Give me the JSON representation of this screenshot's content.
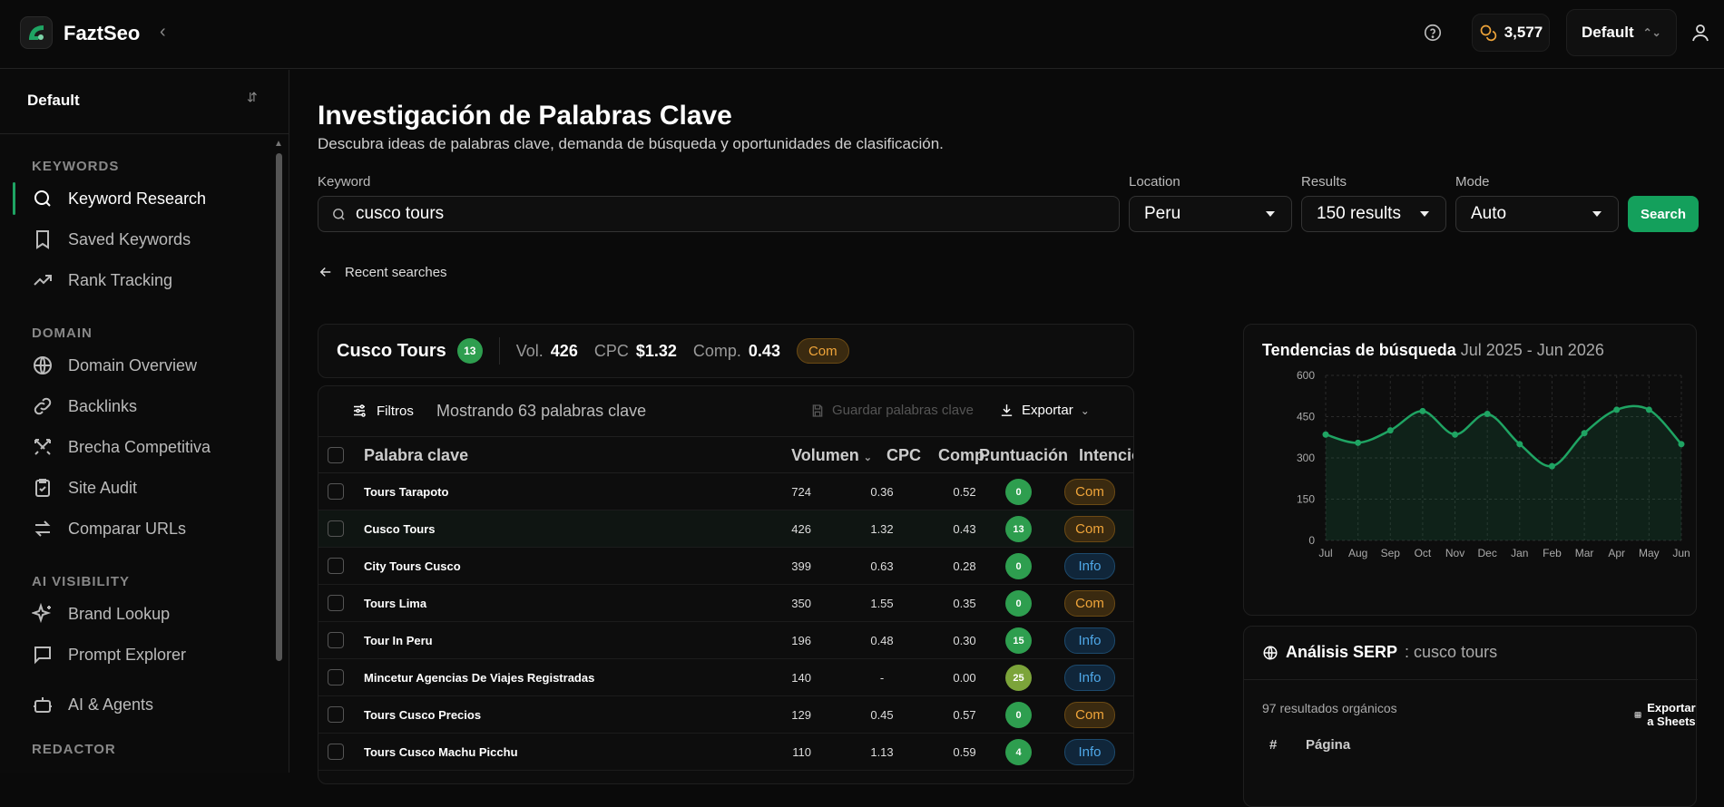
{
  "app": {
    "name": "FaztSeo",
    "credits": "3,577",
    "workspace": "Default"
  },
  "sidebar": {
    "workspace": "Default",
    "sections": {
      "keywords": "KEYWORDS",
      "domain": "DOMAIN",
      "ai_visibility": "AI VISIBILITY",
      "redactor": "REDACTOR"
    },
    "items": [
      {
        "label": "Keyword Research",
        "icon": "search-icon"
      },
      {
        "label": "Saved Keywords",
        "icon": "bookmark-icon"
      },
      {
        "label": "Rank Tracking",
        "icon": "trending-up-icon"
      },
      {
        "label": "Domain Overview",
        "icon": "globe-icon"
      },
      {
        "label": "Backlinks",
        "icon": "link-icon"
      },
      {
        "label": "Brecha Competitiva",
        "icon": "swords-icon"
      },
      {
        "label": "Site Audit",
        "icon": "clipboard-check-icon"
      },
      {
        "label": "Comparar URLs",
        "icon": "arrows-swap-icon"
      },
      {
        "label": "Brand Lookup",
        "icon": "sparkles-icon"
      },
      {
        "label": "Prompt Explorer",
        "icon": "message-square-icon"
      },
      {
        "label": "AI & Agents",
        "icon": "bot-icon"
      }
    ]
  },
  "header": {
    "title": "Investigación de Palabras Clave",
    "subtitle": "Descubra ideas de palabras clave, demanda de búsqueda y oportunidades de clasificación."
  },
  "form": {
    "keyword_label": "Keyword",
    "keyword_value": "cusco tours",
    "location_label": "Location",
    "location_value": "Peru",
    "results_label": "Results",
    "results_value": "150 results",
    "mode_label": "Mode",
    "mode_value": "Auto",
    "search_button": "Search",
    "recent": "Recent searches"
  },
  "summary": {
    "name": "Cusco Tours",
    "score": "13",
    "vol_label": "Vol.",
    "vol": "426",
    "cpc_label": "CPC",
    "cpc": "$1.32",
    "comp_label": "Comp.",
    "comp": "0.43",
    "intent": "Com"
  },
  "table": {
    "filters": "Filtros",
    "showing": "Mostrando 63 palabras clave",
    "save": "Guardar palabras clave",
    "export": "Exportar",
    "headers": {
      "keyword": "Palabra clave",
      "volume": "Volumen",
      "cpc": "CPC",
      "comp": "Comp.",
      "score": "Puntuación",
      "intent": "Intención"
    },
    "rows": [
      {
        "keyword": "Tours Tarapoto",
        "volume": "724",
        "cpc": "0.36",
        "comp": "0.52",
        "score": "0",
        "intent": "Com"
      },
      {
        "keyword": "Cusco Tours",
        "volume": "426",
        "cpc": "1.32",
        "comp": "0.43",
        "score": "13",
        "intent": "Com"
      },
      {
        "keyword": "City Tours Cusco",
        "volume": "399",
        "cpc": "0.63",
        "comp": "0.28",
        "score": "0",
        "intent": "Info"
      },
      {
        "keyword": "Tours Lima",
        "volume": "350",
        "cpc": "1.55",
        "comp": "0.35",
        "score": "0",
        "intent": "Com"
      },
      {
        "keyword": "Tour In Peru",
        "volume": "196",
        "cpc": "0.48",
        "comp": "0.30",
        "score": "15",
        "intent": "Info"
      },
      {
        "keyword": "Mincetur Agencias De Viajes Registradas",
        "volume": "140",
        "cpc": "-",
        "comp": "0.00",
        "score": "25",
        "intent": "Info"
      },
      {
        "keyword": "Tours Cusco Precios",
        "volume": "129",
        "cpc": "0.45",
        "comp": "0.57",
        "score": "0",
        "intent": "Com"
      },
      {
        "keyword": "Tours Cusco Machu Picchu",
        "volume": "110",
        "cpc": "1.13",
        "comp": "0.59",
        "score": "4",
        "intent": "Info"
      }
    ]
  },
  "trends": {
    "title": "Tendencias de búsqueda",
    "range": "Jul 2025 - Jun 2026"
  },
  "chart_data": {
    "type": "area",
    "title": "Tendencias de búsqueda",
    "x": [
      "Jul",
      "Aug",
      "Sep",
      "Oct",
      "Nov",
      "Dec",
      "Jan",
      "Feb",
      "Mar",
      "Apr",
      "May",
      "Jun"
    ],
    "values": [
      385,
      355,
      400,
      470,
      385,
      460,
      350,
      270,
      390,
      475,
      475,
      350
    ],
    "yticks": [
      "0",
      "150",
      "300",
      "450",
      "600"
    ],
    "ylim": [
      0,
      600
    ],
    "grid": true,
    "color": "#1fa463"
  },
  "serp": {
    "title": "Análisis SERP",
    "query": ": cusco tours",
    "organic": "97 resultados orgánicos",
    "export": "Exportar a Sheets",
    "col_num": "#",
    "col_page": "Página"
  }
}
